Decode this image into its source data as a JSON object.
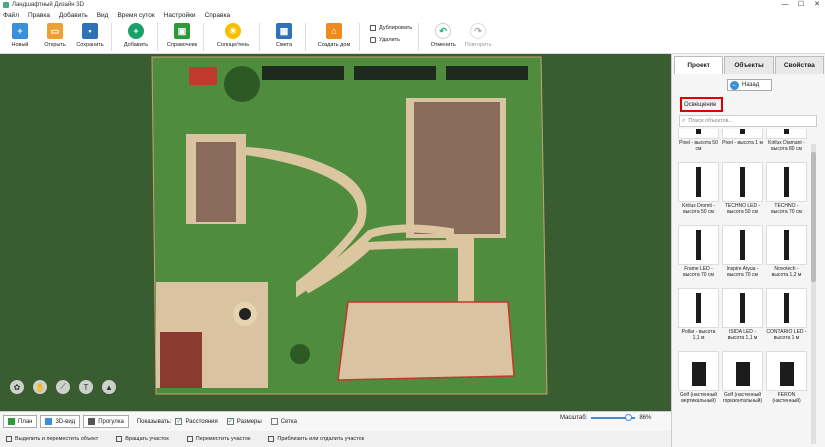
{
  "window": {
    "title": "Ландшафтный Дизайн 3D",
    "controls": [
      "—",
      "☐",
      "✕"
    ]
  },
  "menu": [
    "Файл",
    "Правка",
    "Добавить",
    "Вид",
    "Время суток",
    "Настройки",
    "Справка"
  ],
  "toolbar": {
    "new": "Новый",
    "open": "Открыть",
    "save": "Сохранить",
    "add": "Добавить",
    "guide": "Справочник",
    "sun": "Солнце/тень",
    "estimate": "Смета",
    "house": "Создать дом",
    "duplicate": "Дублировать",
    "delete": "Удалить",
    "undo": "Отменить",
    "redo": "Повторить"
  },
  "panel": {
    "tabs": [
      "Проект",
      "Объекты",
      "Свойства"
    ],
    "back": "Назад",
    "category": "Освещение",
    "search_placeholder": "Поиск объектов...",
    "items": [
      {
        "name": "Pixel - высота 50 см"
      },
      {
        "name": "Pixel - высота 1 м"
      },
      {
        "name": "Kirilux Diamant - высота 80 см"
      },
      {
        "name": "Kirilux Dromit - высота 50 см"
      },
      {
        "name": "TECHNO LED - высота 50 см"
      },
      {
        "name": "TECHNO - высота 70 см"
      },
      {
        "name": "Frame LED - высота 70 см"
      },
      {
        "name": "Inspire Atyua - высота 70 см"
      },
      {
        "name": "Novotech - высота 1,2 м"
      },
      {
        "name": "Pollar - высота 1,1 м"
      },
      {
        "name": "ISIDA LED - высота 1,1 м"
      },
      {
        "name": "CONTARIO LED - высота 1 м"
      },
      {
        "name": "Golf (настенный вертикальный)"
      },
      {
        "name": "Golf (настенный горизонтальный)"
      },
      {
        "name": "FERON (настенный)"
      }
    ]
  },
  "viewbar": {
    "plan": "План",
    "view3d": "3D-вид",
    "walk": "Прогулка",
    "show": "Показывать:",
    "distances": "Расстояния",
    "sizes": "Размеры",
    "grid": "Сетка",
    "zoom_label": "Масштаб:",
    "zoom_value": "86%",
    "zoom_fraction": 0.86
  },
  "checks": {
    "distances": true,
    "sizes": true,
    "grid": false
  },
  "status": [
    "Выделить и переместить объект",
    "Вращать участок",
    "Переместить участок",
    "Приблизить или отдалить участок"
  ],
  "colors": {
    "accent": "#3b8ed8",
    "grass": "#4e8a3c",
    "path": "#d9c3a0",
    "roof": "#8a6a5a",
    "highlight": "#d00000"
  }
}
